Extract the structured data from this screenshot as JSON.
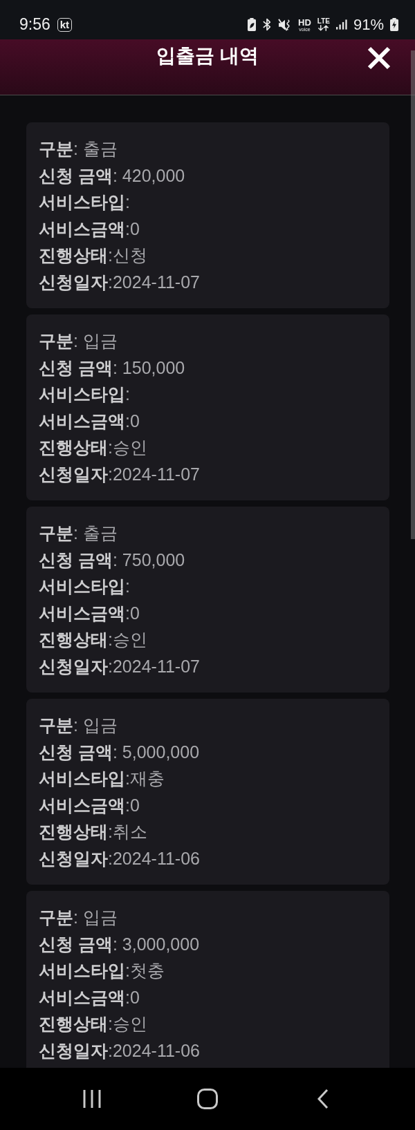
{
  "status_bar": {
    "time": "9:56",
    "carrier": "kt",
    "hd_label": "HD",
    "hd_sub": "voice",
    "network": "LTE",
    "battery": "91%"
  },
  "header": {
    "title": "입출금 내역"
  },
  "records": [
    {
      "lines": [
        "**구분**: 출금",
        "**신청 금액**: 420,000",
        "**서비스타입**:",
        "**서비스금액**:0",
        "**진행상태**:신청",
        "**신청일자**:2024-11-07"
      ]
    },
    {
      "lines": [
        "**구분**: 입금",
        "**신청 금액**: 150,000",
        "**서비스타입**:",
        "**서비스금액**:0",
        "**진행상태**:승인",
        "**신청일자**:2024-11-07"
      ]
    },
    {
      "lines": [
        "**구분**: 출금",
        "**신청 금액**: 750,000",
        "**서비스타입**:",
        "**서비스금액**:0",
        "**진행상태**:승인",
        "**신청일자**:2024-11-07"
      ]
    },
    {
      "lines": [
        "**구분**: 입금",
        "**신청 금액**: 5,000,000",
        "**서비스타입**:재충",
        "**서비스금액**:0",
        "**진행상태**:취소",
        "**신청일자**:2024-11-06"
      ]
    },
    {
      "lines": [
        "**구분**: 입금",
        "**신청 금액**: 3,000,000",
        "**서비스타입**:첫충",
        "**서비스금액**:0",
        "**진행상태**:승인",
        "**신청일자**:2024-11-06"
      ]
    }
  ]
}
